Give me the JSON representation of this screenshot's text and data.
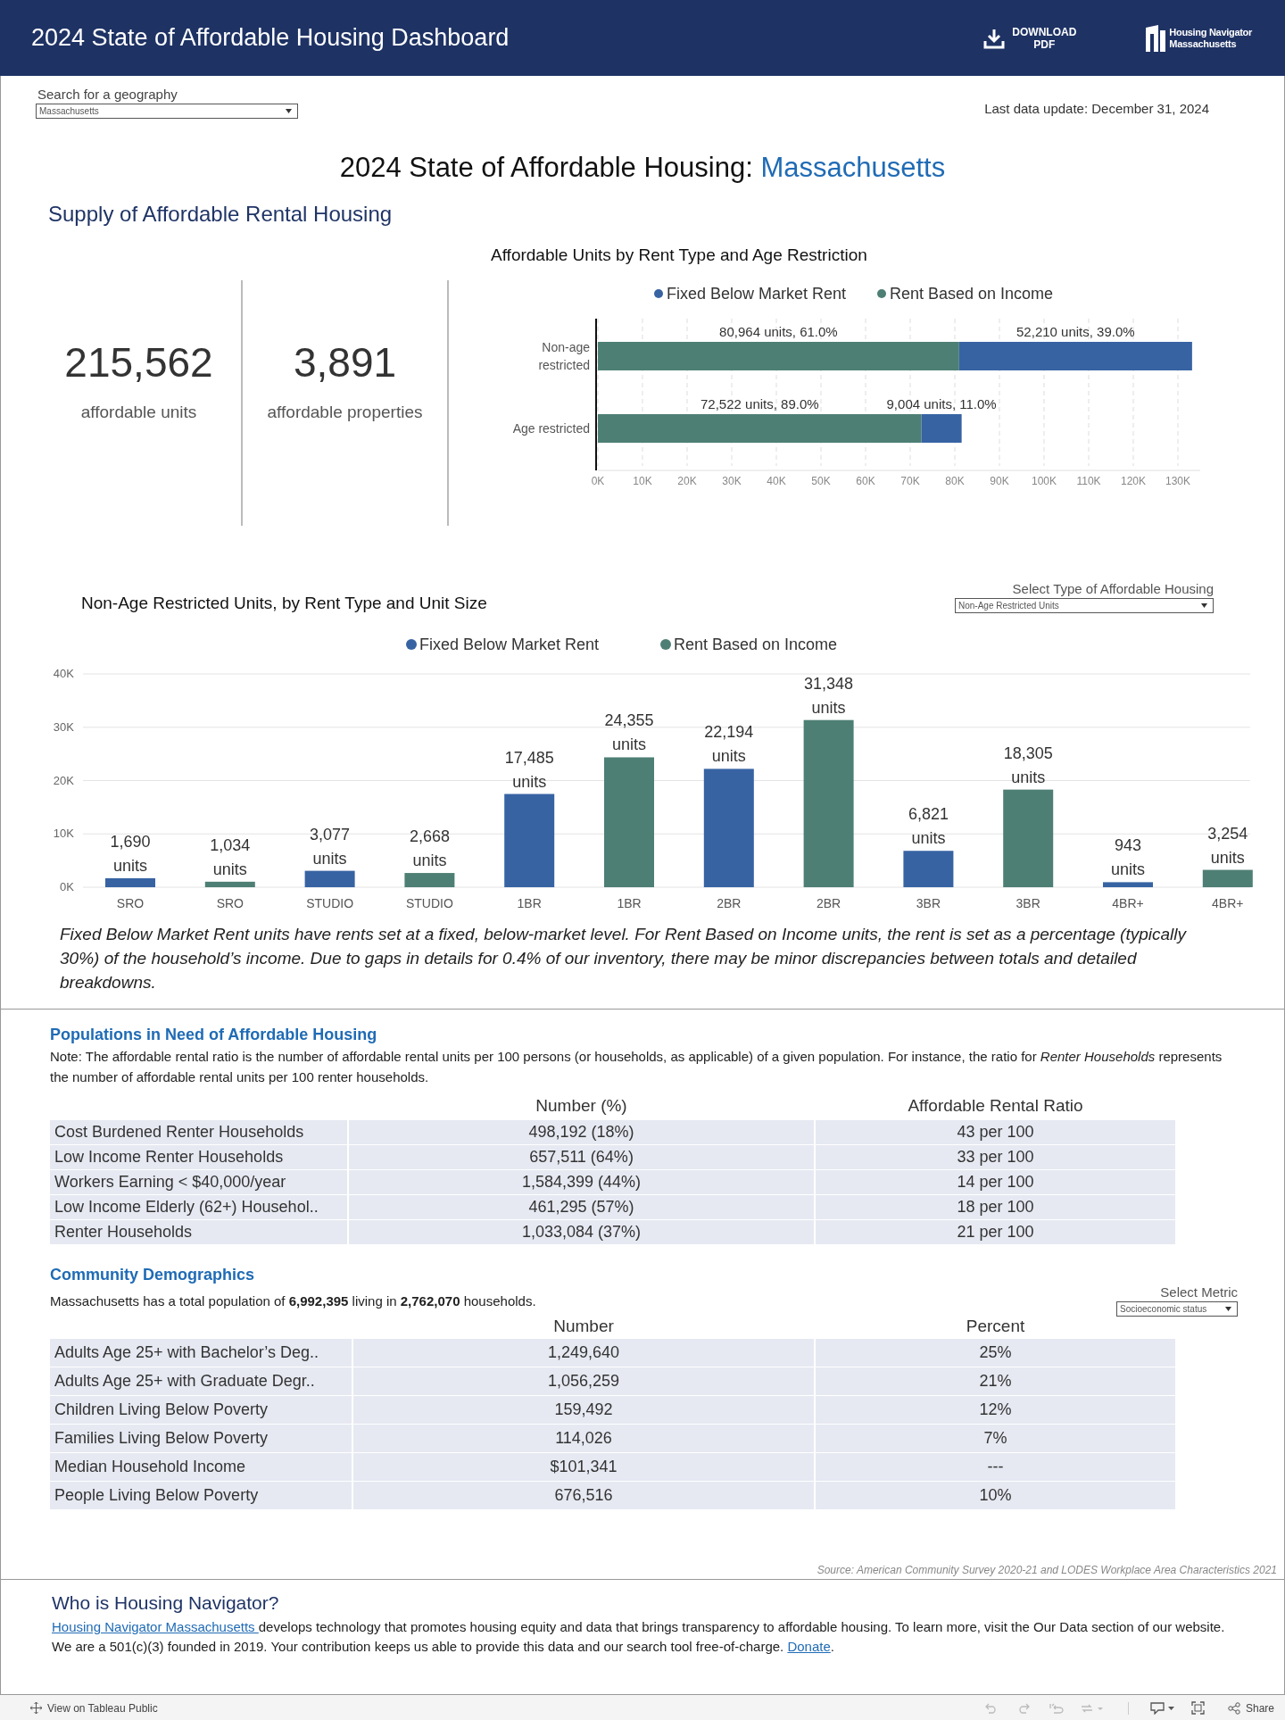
{
  "header": {
    "title": "2024 State of Affordable Housing Dashboard",
    "download_label": "DOWNLOAD\nPDF",
    "logo_text": "Housing Navigator\nMassachusetts"
  },
  "geography": {
    "label": "Search for a geography",
    "value": "Massachusetts"
  },
  "last_update": "Last data update: December 31, 2024",
  "page_title": {
    "prefix": "2024 State of Affordable Housing:",
    "place": "Massachusetts"
  },
  "supply": {
    "heading": "Supply of Affordable Rental Housing",
    "kpis": [
      {
        "value": "215,562",
        "label": "affordable units"
      },
      {
        "value": "3,891",
        "label": "affordable properties"
      }
    ],
    "age_chart": {
      "title": "Affordable Units by Rent Type and Age Restriction",
      "chart_data": {
        "type": "bar",
        "orientation": "horizontal",
        "stacked": true,
        "categories": [
          "Non-age\nrestricted",
          "Age restricted"
        ],
        "series": [
          {
            "name": "Fixed Below Market Rent",
            "color": "#3763a3",
            "values": [
              52210,
              9004
            ]
          },
          {
            "name": "Rent Based on Income",
            "color": "#4e7f74",
            "values": [
              80964,
              72522
            ]
          }
        ],
        "value_labels": [
          [
            "52,210 units, 39.0%",
            "9,004 units, 11.0%"
          ],
          [
            "80,964 units, 61.0%",
            "72,522 units, 89.0%"
          ]
        ],
        "xlim": [
          0,
          135000
        ],
        "grid": true,
        "legend": true,
        "xticks": [
          {
            "value": 0,
            "label": "0K"
          },
          {
            "value": 10000,
            "label": "10K"
          },
          {
            "value": 20000,
            "label": "20K"
          },
          {
            "value": 30000,
            "label": "30K"
          },
          {
            "value": 40000,
            "label": "40K"
          },
          {
            "value": 50000,
            "label": "50K"
          },
          {
            "value": 60000,
            "label": "60K"
          },
          {
            "value": 70000,
            "label": "70K"
          },
          {
            "value": 80000,
            "label": "80K"
          },
          {
            "value": 90000,
            "label": "90K"
          },
          {
            "value": 100000,
            "label": "100K"
          },
          {
            "value": 110000,
            "label": "110K"
          },
          {
            "value": 120000,
            "label": "120K"
          },
          {
            "value": 130000,
            "label": "130K"
          }
        ]
      }
    },
    "size_chart": {
      "title": "Non-Age Restricted Units, by Rent Type and Unit Size",
      "select": {
        "label": "Select Type of Affordable Housing",
        "value": "Non-Age Restricted Units"
      },
      "chart_data": {
        "type": "bar",
        "categories": [
          "SRO",
          "SRO",
          "STUDIO",
          "STUDIO",
          "1BR",
          "1BR",
          "2BR",
          "2BR",
          "3BR",
          "3BR",
          "4BR+",
          "4BR+"
        ],
        "series": [
          {
            "name": "Fixed Below Market Rent",
            "color": "#3763a3",
            "values": [
              1690,
              null,
              3077,
              null,
              17485,
              null,
              22194,
              null,
              6821,
              null,
              943,
              null
            ]
          },
          {
            "name": "Rent Based on Income",
            "color": "#4e7f74",
            "values": [
              null,
              1034,
              null,
              2668,
              null,
              24355,
              null,
              31348,
              null,
              18305,
              null,
              3254
            ]
          }
        ],
        "value_labels": [
          [
            "1,690\nunits",
            null,
            "3,077\nunits",
            null,
            "17,485\nunits",
            null,
            "22,194\nunits",
            null,
            "6,821\nunits",
            null,
            "943\nunits",
            null
          ],
          [
            null,
            "1,034\nunits",
            null,
            "2,668\nunits",
            null,
            "24,355\nunits",
            null,
            "31,348\nunits",
            null,
            "18,305\nunits",
            null,
            "3,254\nunits"
          ]
        ],
        "ylim": [
          0,
          40000
        ],
        "grid": true,
        "legend": true,
        "yticks": [
          {
            "value": 0,
            "label": "0K"
          },
          {
            "value": 10000,
            "label": "10K"
          },
          {
            "value": 20000,
            "label": "20K"
          },
          {
            "value": 30000,
            "label": "30K"
          },
          {
            "value": 40000,
            "label": "40K"
          }
        ]
      }
    },
    "caption": "Fixed Below Market Rent units have rents set at a fixed, below-market level. For Rent Based on Income units, the rent is set as a percentage (typically 30%) of the household’s income. Due to gaps in details for 0.4% of our inventory, there may be minor discrepancies between totals and detailed breakdowns."
  },
  "populations": {
    "title": "Populations in Need of Affordable Housing",
    "note": "Note: The affordable rental ratio is the number of affordable rental units per 100 persons (or households, as applicable) of a given population. For instance, the ratio for *Renter Households* represents the number of affordable rental units per 100 renter households.",
    "columns": [
      "Number (%)",
      "Affordable Rental Ratio"
    ],
    "rows": [
      {
        "label": "Cost Burdened Renter Households",
        "number": "498,192 (18%)",
        "ratio": "43 per 100"
      },
      {
        "label": "Low Income Renter Households",
        "number": "657,511 (64%)",
        "ratio": "33 per 100"
      },
      {
        "label": "Workers Earning < $40,000/year",
        "number": "1,584,399 (44%)",
        "ratio": "14 per 100"
      },
      {
        "label": "Low Income Elderly (62+) Househol..",
        "number": "461,295 (57%)",
        "ratio": "18 per 100"
      },
      {
        "label": "Renter Households",
        "number": "1,033,084 (37%)",
        "ratio": "21 per 100"
      }
    ]
  },
  "demographics": {
    "title": "Community Demographics",
    "summary": "Massachusetts has a total population of **6,992,395** living in **2,762,070** households.",
    "select": {
      "label": "Select Metric",
      "value": "Socioeconomic status"
    },
    "columns": [
      "Number",
      "Percent"
    ],
    "rows": [
      {
        "label": "Adults Age 25+ with Bachelor’s Deg..",
        "number": "1,249,640",
        "percent": "25%"
      },
      {
        "label": "Adults Age 25+ with Graduate Degr..",
        "number": "1,056,259",
        "percent": "21%"
      },
      {
        "label": "Children Living Below Poverty",
        "number": "159,492",
        "percent": "12%"
      },
      {
        "label": "Families Living Below Poverty",
        "number": "114,026",
        "percent": "7%"
      },
      {
        "label": "Median Household Income",
        "number": "$101,341",
        "percent": "---"
      },
      {
        "label": "People Living Below Poverty",
        "number": "676,516",
        "percent": "10%"
      }
    ]
  },
  "source": "Source: American Community Survey 2020-21 and LODES Workplace Area Characteristics 2021",
  "about": {
    "title": "Who is Housing Navigator?",
    "link_text": "Housing Navigator Massachusetts ",
    "text": "develops technology that promotes housing equity and data that brings transparency to affordable housing. To learn more, visit the Our Data section of our website. We are a 501(c)(3) founded in 2019. Your contribution keeps us able to provide this data and our search tool free-of-charge. ",
    "donate_link": "Donate",
    "end": "."
  },
  "toolbar": {
    "view_link": "View on Tableau Public",
    "share": "Share"
  }
}
